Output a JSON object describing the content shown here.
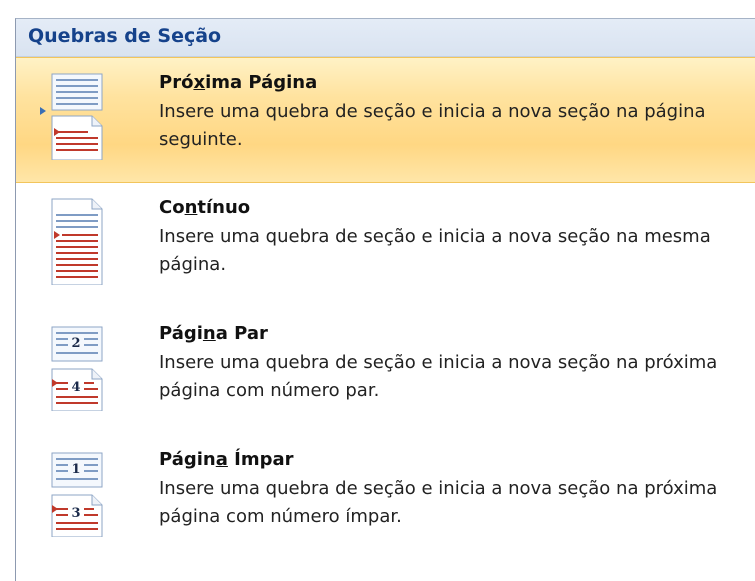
{
  "menu": {
    "header": "Quebras de Seção",
    "items": [
      {
        "title_pre": "Pró",
        "title_ul": "x",
        "title_post": "ima Página",
        "desc": "Insere uma quebra de seção e inicia a nova seção na página seguinte.",
        "icon": "next-page-icon",
        "highlighted": true
      },
      {
        "title_pre": "Co",
        "title_ul": "n",
        "title_post": "tínuo",
        "desc": "Insere uma quebra de seção e inicia a nova seção na mesma página.",
        "icon": "continuous-icon",
        "highlighted": false
      },
      {
        "title_pre": "Pági",
        "title_ul": "n",
        "title_post": "a Par",
        "desc": "Insere uma quebra de seção e inicia a nova seção na próxima página com número par.",
        "icon": "even-page-icon",
        "page_numbers": [
          "2",
          "4"
        ],
        "highlighted": false
      },
      {
        "title_pre": "Págin",
        "title_ul": "a",
        "title_post": " Ímpar",
        "desc": "Insere uma quebra de seção e inicia a nova seção na próxima página com número ímpar.",
        "icon": "odd-page-icon",
        "page_numbers": [
          "1",
          "3"
        ],
        "highlighted": false
      }
    ]
  },
  "colors": {
    "header_text": "#15428b",
    "highlight": "#ffd783",
    "break_line": "#c0392b",
    "page_line": "#7f9cc4"
  }
}
